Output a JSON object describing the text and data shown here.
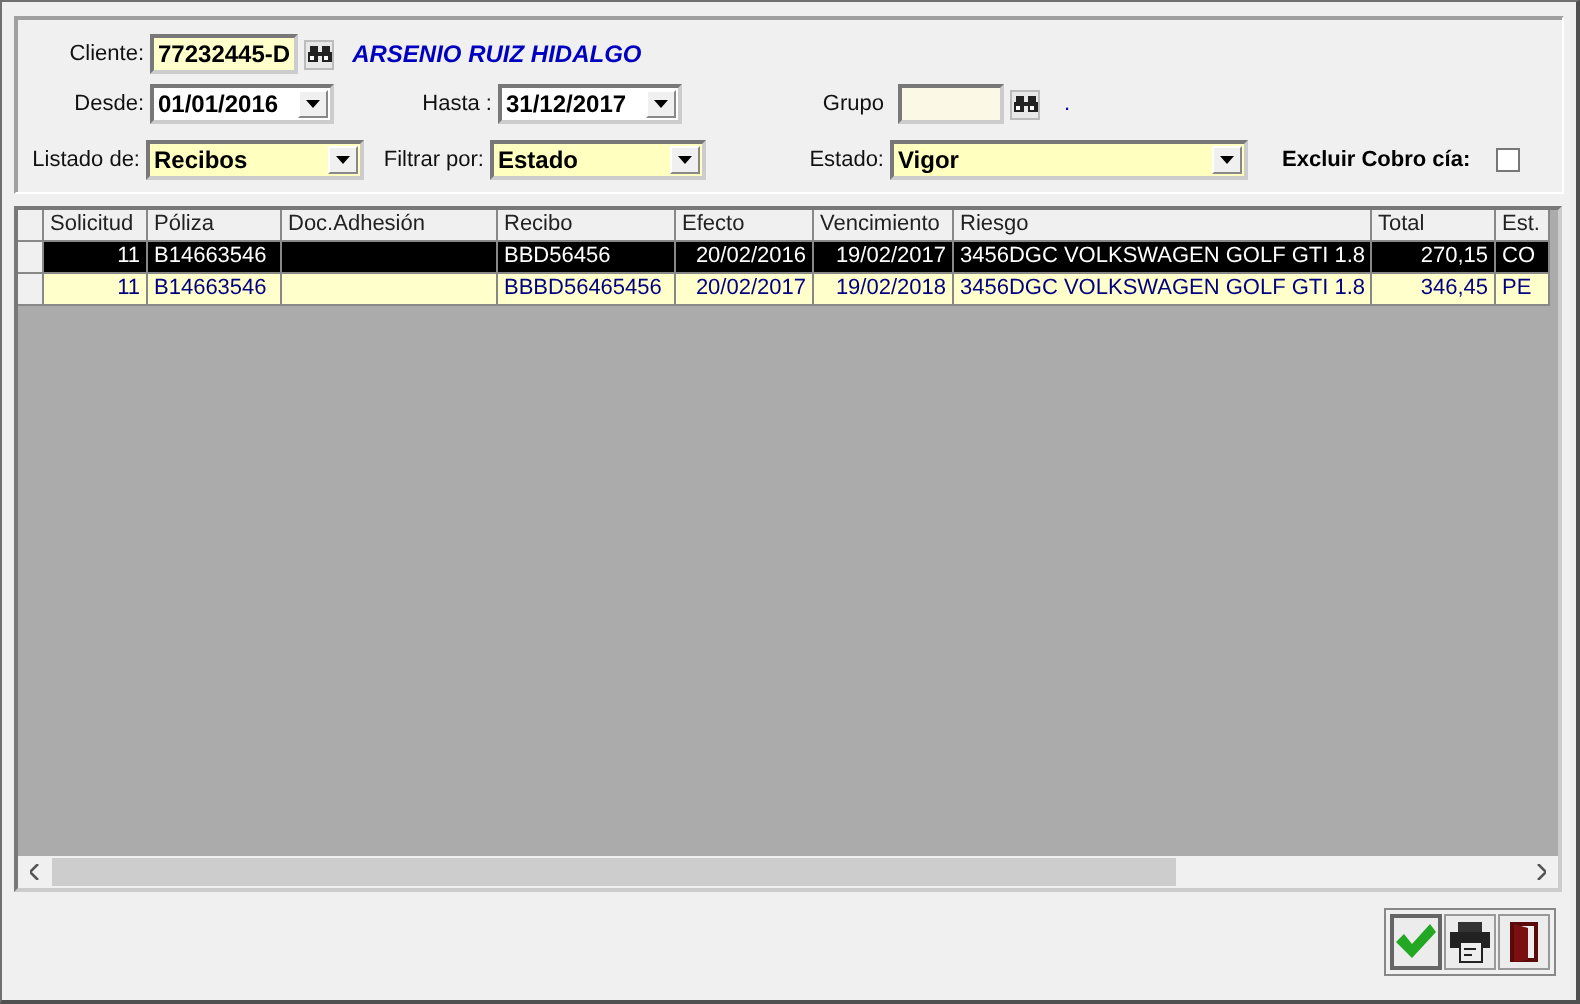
{
  "filters": {
    "cliente": {
      "label": "Cliente:",
      "value": "77232445-D",
      "name": "ARSENIO RUIZ HIDALGO"
    },
    "desde": {
      "label": "Desde:",
      "value": "01/01/2016"
    },
    "hasta": {
      "label": "Hasta :",
      "value": "31/12/2017"
    },
    "grupo": {
      "label": "Grupo",
      "dot": "."
    },
    "listado": {
      "label": "Listado de:",
      "value": "Recibos"
    },
    "filtrar": {
      "label": "Filtrar por:",
      "value": "Estado"
    },
    "estado": {
      "label": "Estado:",
      "value": "Vigor"
    },
    "excluir": {
      "label": "Excluir Cobro cía:",
      "checked": false
    }
  },
  "table": {
    "columns": [
      "Solicitud",
      "Póliza",
      "Doc.Adhesión",
      "Recibo",
      "Efecto",
      "Vencimiento",
      "Riesgo",
      "Total",
      "Est."
    ],
    "rows": [
      {
        "selected": true,
        "cells": [
          "11",
          "B14663546",
          "",
          "BBD56456",
          "20/02/2016",
          "19/02/2017",
          "3456DGC VOLKSWAGEN GOLF GTI 1.8",
          "270,15",
          "CO"
        ]
      },
      {
        "selected": false,
        "cells": [
          "11",
          "B14663546",
          "",
          "BBBD56465456",
          "20/02/2017",
          "19/02/2018",
          "3456DGC VOLKSWAGEN GOLF GTI 1.8",
          "346,45",
          "PE"
        ]
      }
    ]
  },
  "buttons": [
    {
      "kind": "accept"
    },
    {
      "kind": "print"
    },
    {
      "kind": "exit"
    }
  ]
}
